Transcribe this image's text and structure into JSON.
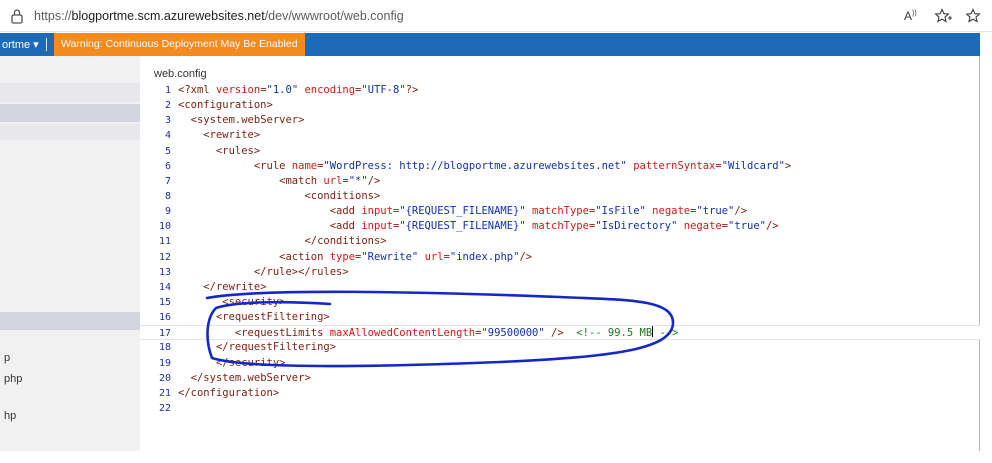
{
  "browser": {
    "url_prefix": "https://",
    "url_host": "blogportme.scm.azurewebsites.net",
    "url_path": "/dev/wwwroot/web.config",
    "read_aloud_glyph": "A",
    "icons": [
      "lock-icon",
      "read-aloud-icon",
      "favorite-star-icon",
      "favorites-icon"
    ]
  },
  "nav": {
    "menu_label": "ortme ▾",
    "warning": "Warning: Continuous Deployment May Be Enabled",
    "colors": {
      "bar": "#1f6ab5",
      "warning": "#f58b1f"
    }
  },
  "sidebar": {
    "items": [
      "p",
      "php",
      "hp"
    ]
  },
  "editor": {
    "file_name": "web.config",
    "active_line": 17,
    "annotation_color": "#1428c8",
    "lines": [
      {
        "n": "1",
        "indent": "",
        "parts": [
          [
            "tag",
            "<?xml "
          ],
          [
            "attr",
            "version"
          ],
          [
            "tag",
            "="
          ],
          [
            "val",
            "\"1.0\""
          ],
          [
            "tag",
            " "
          ],
          [
            "attr",
            "encoding"
          ],
          [
            "tag",
            "="
          ],
          [
            "val",
            "\"UTF-8\""
          ],
          [
            "tag",
            "?>"
          ]
        ]
      },
      {
        "n": "2",
        "indent": "",
        "parts": [
          [
            "tag",
            "<configuration>"
          ]
        ]
      },
      {
        "n": "3",
        "indent": "  ",
        "parts": [
          [
            "tag",
            "<system.webServer>"
          ]
        ]
      },
      {
        "n": "4",
        "indent": "    ",
        "parts": [
          [
            "tag",
            "<rewrite>"
          ]
        ]
      },
      {
        "n": "5",
        "indent": "      ",
        "parts": [
          [
            "tag",
            "<rules>"
          ]
        ]
      },
      {
        "n": "6",
        "indent": "            ",
        "parts": [
          [
            "tag",
            "<rule "
          ],
          [
            "attr",
            "name"
          ],
          [
            "tag",
            "="
          ],
          [
            "val",
            "\"WordPress: http://blogportme.azurewebsites.net\""
          ],
          [
            "tag",
            " "
          ],
          [
            "attr",
            "patternSyntax"
          ],
          [
            "tag",
            "="
          ],
          [
            "val",
            "\"Wildcard\""
          ],
          [
            "tag",
            ">"
          ]
        ]
      },
      {
        "n": "7",
        "indent": "                ",
        "parts": [
          [
            "tag",
            "<match "
          ],
          [
            "attr",
            "url"
          ],
          [
            "tag",
            "="
          ],
          [
            "val",
            "\"*\""
          ],
          [
            "tag",
            "/>"
          ]
        ]
      },
      {
        "n": "8",
        "indent": "                    ",
        "parts": [
          [
            "tag",
            "<conditions>"
          ]
        ]
      },
      {
        "n": "9",
        "indent": "                        ",
        "parts": [
          [
            "tag",
            "<add "
          ],
          [
            "attr",
            "input"
          ],
          [
            "tag",
            "="
          ],
          [
            "val",
            "\"{REQUEST_FILENAME}\""
          ],
          [
            "tag",
            " "
          ],
          [
            "attr",
            "matchType"
          ],
          [
            "tag",
            "="
          ],
          [
            "val",
            "\"IsFile\""
          ],
          [
            "tag",
            " "
          ],
          [
            "attr",
            "negate"
          ],
          [
            "tag",
            "="
          ],
          [
            "val",
            "\"true\""
          ],
          [
            "tag",
            "/>"
          ]
        ]
      },
      {
        "n": "10",
        "indent": "                        ",
        "parts": [
          [
            "tag",
            "<add "
          ],
          [
            "attr",
            "input"
          ],
          [
            "tag",
            "="
          ],
          [
            "val",
            "\"{REQUEST_FILENAME}\""
          ],
          [
            "tag",
            " "
          ],
          [
            "attr",
            "matchType"
          ],
          [
            "tag",
            "="
          ],
          [
            "val",
            "\"IsDirectory\""
          ],
          [
            "tag",
            " "
          ],
          [
            "attr",
            "negate"
          ],
          [
            "tag",
            "="
          ],
          [
            "val",
            "\"true\""
          ],
          [
            "tag",
            "/>"
          ]
        ]
      },
      {
        "n": "11",
        "indent": "                    ",
        "parts": [
          [
            "tag",
            "</conditions>"
          ]
        ]
      },
      {
        "n": "12",
        "indent": "                ",
        "parts": [
          [
            "tag",
            "<action "
          ],
          [
            "attr",
            "type"
          ],
          [
            "tag",
            "="
          ],
          [
            "val",
            "\"Rewrite\""
          ],
          [
            "tag",
            " "
          ],
          [
            "attr",
            "url"
          ],
          [
            "tag",
            "="
          ],
          [
            "val",
            "\"index.php\""
          ],
          [
            "tag",
            "/>"
          ]
        ]
      },
      {
        "n": "13",
        "indent": "            ",
        "parts": [
          [
            "tag",
            "</rule></rules>"
          ]
        ]
      },
      {
        "n": "14",
        "indent": "    ",
        "parts": [
          [
            "tag",
            "</rewrite>"
          ]
        ]
      },
      {
        "n": "15",
        "indent": "       ",
        "parts": [
          [
            "tag",
            "<security>"
          ]
        ]
      },
      {
        "n": "16",
        "indent": "      ",
        "parts": [
          [
            "tag",
            "<requestFiltering>"
          ]
        ]
      },
      {
        "n": "17",
        "indent": "         ",
        "parts": [
          [
            "tag",
            "<requestLimits "
          ],
          [
            "attr",
            "maxAllowedContentLength"
          ],
          [
            "tag",
            "="
          ],
          [
            "val",
            "\"99500000\""
          ],
          [
            "tag",
            " />  "
          ],
          [
            "cmt",
            "<!-- 99.5 MB"
          ],
          [
            "caret",
            ""
          ],
          [
            "cmt",
            " -->"
          ]
        ]
      },
      {
        "n": "18",
        "indent": "      ",
        "parts": [
          [
            "tag",
            "</requestFiltering>"
          ]
        ]
      },
      {
        "n": "19",
        "indent": "      ",
        "parts": [
          [
            "tag",
            "</security>"
          ]
        ]
      },
      {
        "n": "20",
        "indent": "  ",
        "parts": [
          [
            "tag",
            "</system.webServer>"
          ]
        ]
      },
      {
        "n": "21",
        "indent": "",
        "parts": [
          [
            "tag",
            "</configuration>"
          ]
        ]
      },
      {
        "n": "22",
        "indent": "",
        "parts": []
      }
    ]
  }
}
